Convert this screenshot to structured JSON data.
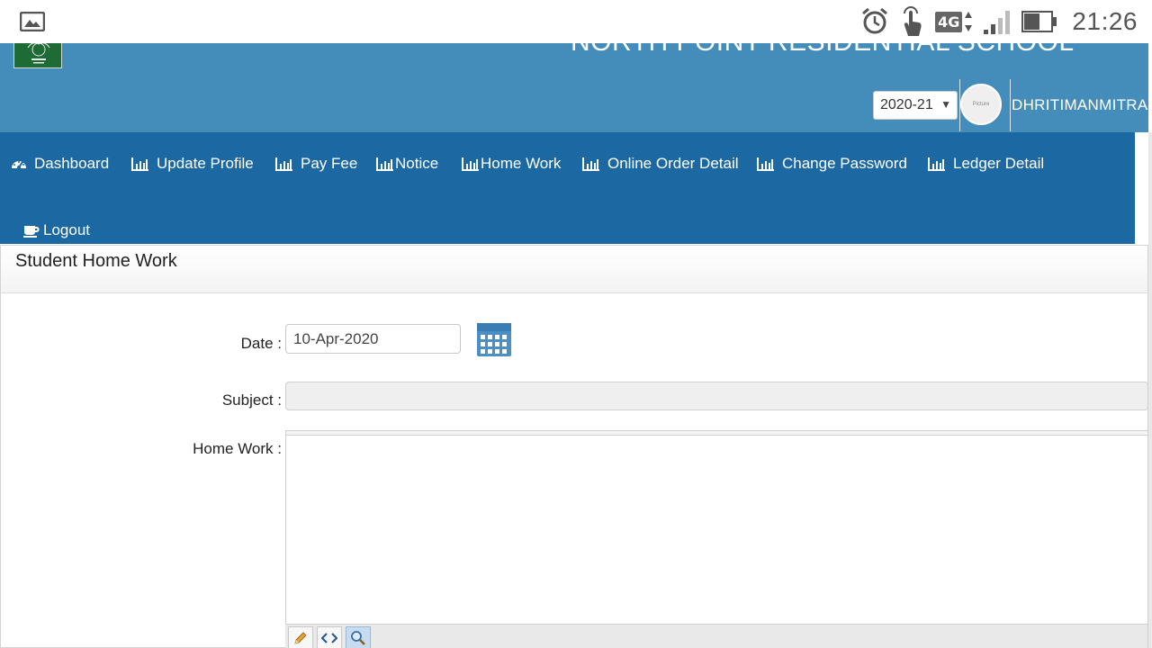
{
  "status_bar": {
    "time": "21:26",
    "network": "4G",
    "icons": [
      "gallery-icon",
      "alarm-icon",
      "touch-icon",
      "network-4g-icon",
      "signal-icon",
      "battery-icon"
    ]
  },
  "header": {
    "school_name": "NORTH POINT RESIDENTIAL SCHOOL",
    "session": "2020-21",
    "avatar_text": "Picture",
    "username": "DHRITIMANMITRA"
  },
  "nav": {
    "items": [
      {
        "label": "Dashboard",
        "icon": "dashboard-icon"
      },
      {
        "label": "Update Profile",
        "icon": "bar-chart-icon"
      },
      {
        "label": "Pay Fee",
        "icon": "bar-chart-icon"
      },
      {
        "label": "Notice",
        "icon": "bar-chart-icon"
      },
      {
        "label": "Home Work",
        "icon": "bar-chart-icon"
      },
      {
        "label": "Online Order Detail",
        "icon": "bar-chart-icon"
      },
      {
        "label": "Change Password",
        "icon": "bar-chart-icon"
      },
      {
        "label": "Ledger Detail",
        "icon": "bar-chart-icon"
      },
      {
        "label": "Logout",
        "icon": "coffee-icon"
      }
    ]
  },
  "panel": {
    "title": "Student Home Work",
    "date_label": "Date :",
    "date_value": "10-Apr-2020",
    "subject_label": "Subject :",
    "homework_label": "Home Work :"
  },
  "colors": {
    "header_bg": "#448dbb",
    "nav_bg": "#1b68a2",
    "logo_bg": "#1e6b36"
  }
}
